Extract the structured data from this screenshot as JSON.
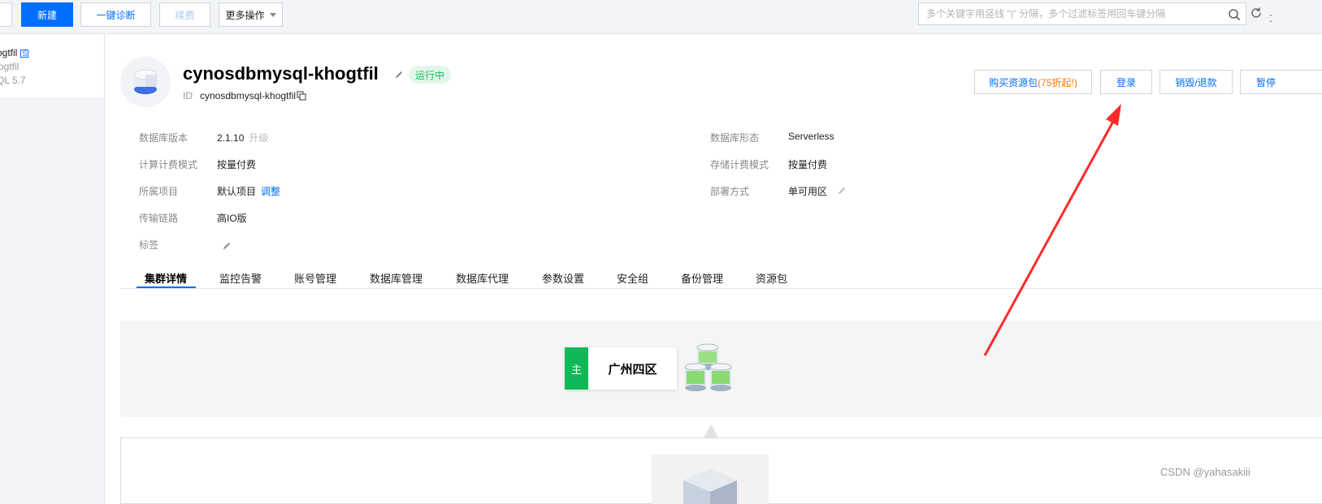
{
  "toolbar": {
    "new_label": "新建",
    "diagnose_label": "一键诊断",
    "renew_label": "续费",
    "more_label": "更多操作",
    "search_placeholder": "多个关键字用竖线 \"|\" 分隔，多个过滤标签用回车键分隔",
    "overflow": "⁚"
  },
  "sidebar": {
    "name": "ogtfil",
    "badge": "S",
    "sub": "ogtfil",
    "version": "QL 5.7"
  },
  "header": {
    "title": "cynosdbmysql-khogtfil",
    "status": "运行中",
    "id_label": "ID",
    "id_value": "cynosdbmysql-khogtfil",
    "buy_label": "购买资源包",
    "buy_promo": "(75折起!)",
    "login_label": "登录",
    "destroy_label": "销毁/退款",
    "pause_label": "暂停"
  },
  "info": {
    "left": [
      {
        "label": "数据库版本",
        "value": "2.1.10",
        "extra": "升级"
      },
      {
        "label": "计算计费模式",
        "value": "按量付费"
      },
      {
        "label": "所属项目",
        "value": "默认项目",
        "link": "调整"
      },
      {
        "label": "传输链路",
        "value": "高IO版"
      },
      {
        "label": "标签",
        "value": ""
      }
    ],
    "right": [
      {
        "label": "数据库形态",
        "value": "Serverless"
      },
      {
        "label": "存储计费模式",
        "value": "按量付费"
      },
      {
        "label": "部署方式",
        "value": "单可用区"
      }
    ]
  },
  "tabs": [
    "集群详情",
    "监控告警",
    "账号管理",
    "数据库管理",
    "数据库代理",
    "参数设置",
    "安全组",
    "备份管理",
    "资源包"
  ],
  "topology": {
    "primary_tag": "主",
    "zone_name": "广州四区"
  },
  "colors": {
    "brand": "#006eff",
    "success": "#0abf5b",
    "annotation_arrow": "#ff2a2a"
  },
  "watermark": "CSDN @yahasakiii"
}
